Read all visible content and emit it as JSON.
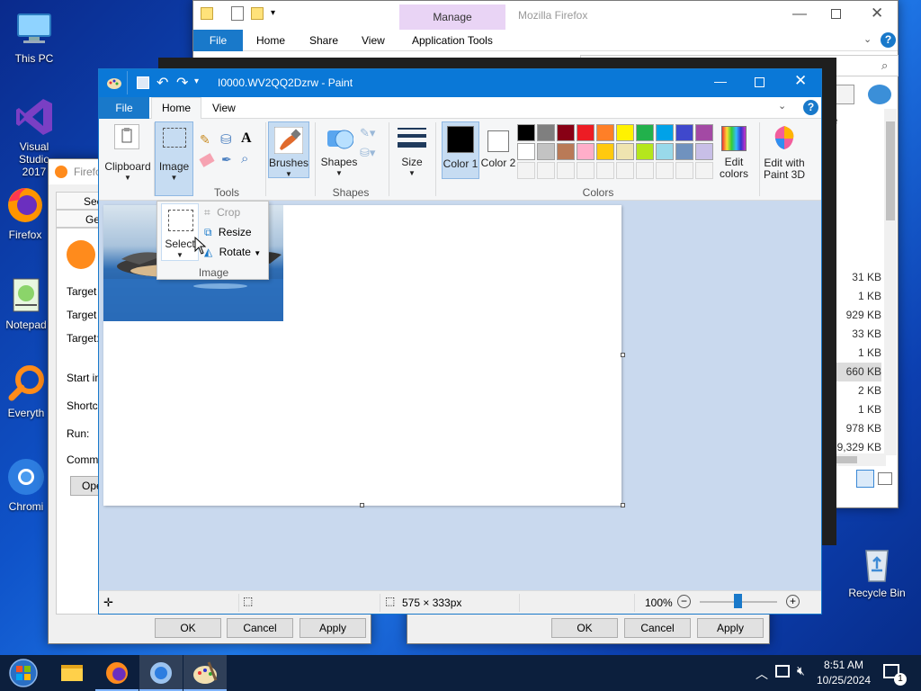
{
  "desktop": {
    "icons": [
      {
        "label": "This PC",
        "icon": "computer-icon"
      },
      {
        "label": "Visual Studio 2017",
        "icon": "visual-studio-icon"
      },
      {
        "label": "Firefox",
        "icon": "firefox-icon"
      },
      {
        "label": "Notepad",
        "icon": "notepad-icon"
      },
      {
        "label": "Everyth",
        "icon": "everything-icon"
      },
      {
        "label": "Chromi",
        "icon": "chromium-icon"
      },
      {
        "label": "Recycle Bin",
        "icon": "recycle-bin-icon"
      }
    ]
  },
  "explorer": {
    "title": "Mozilla Firefox",
    "manage_label": "Manage",
    "tabs": [
      "File",
      "Home",
      "Share",
      "View",
      "Application Tools"
    ],
    "sizes": [
      "31 KB",
      "1 KB",
      "929 KB",
      "33 KB",
      "1 KB",
      "660 KB",
      "2 KB",
      "1 KB",
      "978 KB",
      "9,329 KB"
    ],
    "letter_e": "e"
  },
  "shortcut_props": {
    "title": "Firefo",
    "tabs": [
      "Secu",
      "Ge"
    ],
    "rows": [
      "Target t",
      "Target l",
      "Target:",
      "Start in:",
      "Shortcu",
      "Run:",
      "Comme"
    ],
    "open_button": "Ope",
    "buttons": {
      "ok": "OK",
      "cancel": "Cancel",
      "apply": "Apply"
    }
  },
  "dialog2": {
    "buttons": {
      "ok": "OK",
      "cancel": "Cancel",
      "apply": "Apply"
    }
  },
  "paint": {
    "title": "I0000.WV2QQ2Dzrw - Paint",
    "tabs": {
      "file": "File",
      "home": "Home",
      "view": "View"
    },
    "groups": {
      "clipboard": "Clipboard",
      "image": "Image",
      "tools": "Tools",
      "brushes": "Brushes",
      "shapes": "Shapes",
      "shapes_group": "Shapes",
      "size": "Size",
      "color1": "Color 1",
      "color2": "Color 2",
      "colors": "Colors",
      "edit_colors": "Edit colors",
      "edit_paint3d": "Edit with Paint 3D"
    },
    "image_dropdown": {
      "select": "Select",
      "crop": "Crop",
      "resize": "Resize",
      "rotate": "Rotate",
      "footer": "Image"
    },
    "palette_colors": [
      "#000000",
      "#7f7f7f",
      "#880015",
      "#ed1c24",
      "#ff7f27",
      "#fff200",
      "#22b14c",
      "#00a2e8",
      "#3f48cc",
      "#a349a4",
      "#ffffff",
      "#c3c3c3",
      "#b97a57",
      "#ffaec9",
      "#ffc90e",
      "#efe4b0",
      "#b5e61d",
      "#99d9ea",
      "#7092be",
      "#c8bfe7"
    ],
    "color1_value": "#000000",
    "color2_value": "#ffffff",
    "status": {
      "size": "575 × 333px",
      "zoom": "100%"
    }
  },
  "taskbar": {
    "time": "8:51 AM",
    "date": "10/25/2024",
    "notification_count": "1"
  }
}
